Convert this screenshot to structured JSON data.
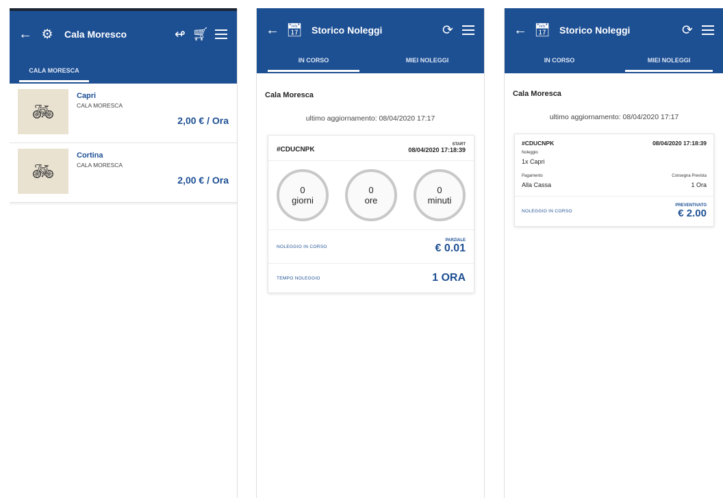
{
  "screen1": {
    "title": "Cala Moresco",
    "tab": "CALA MORESCA",
    "products": [
      {
        "name": "Capri",
        "location": "CALA MORESCA",
        "price": "2,00 € / Ora"
      },
      {
        "name": "Cortina",
        "location": "CALA MORESCA",
        "price": "2,00 € / Ora"
      }
    ]
  },
  "screen2": {
    "title": "Storico Noleggi",
    "tabs": [
      "IN CORSO",
      "MIEI NOLEGGI"
    ],
    "location": "Cala Moresca",
    "updated": "ultimo aggiornamento: 08/04/2020 17:17",
    "card": {
      "code": "#CDUCNPK",
      "start_label": "START",
      "start": "08/04/2020 17:18:39",
      "circles": [
        {
          "value": "0",
          "label": "giorni"
        },
        {
          "value": "0",
          "label": "ore"
        },
        {
          "value": "0",
          "label": "minuti"
        }
      ],
      "rows": [
        {
          "label": "NOLEGGIO IN CORSO",
          "value_label": "PARZIALE",
          "value": "€ 0.01"
        },
        {
          "label": "TEMPO NOLEGGIO",
          "value_label": "",
          "value": "1 ORA"
        }
      ]
    }
  },
  "screen3": {
    "title": "Storico Noleggi",
    "tabs": [
      "IN CORSO",
      "MIEI NOLEGGI"
    ],
    "location": "Cala Moresca",
    "updated": "ultimo aggiornamento: 08/04/2020 17:17",
    "card": {
      "code": "#CDUCNPK",
      "date": "08/04/2020 17:18:39",
      "product_label": "Noleggio",
      "product": "1x Capri",
      "payment_label": "Pagamento",
      "payment": "Alla Cassa",
      "duration_label": "Consegna Prevista",
      "duration": "1 Ora",
      "footer_label": "NOLEGGIO IN CORSO",
      "total_label": "PREVENTIVATO",
      "total": "€ 2.00"
    }
  },
  "colors": {
    "primary": "#1d4f93",
    "thumb_bg": "#eae2d0"
  },
  "icons": [
    "back-arrow-icon",
    "bike-logo-icon",
    "key-icon",
    "cart-icon",
    "menu-icon",
    "calendar-icon",
    "refresh-icon",
    "bicycle-icon"
  ]
}
